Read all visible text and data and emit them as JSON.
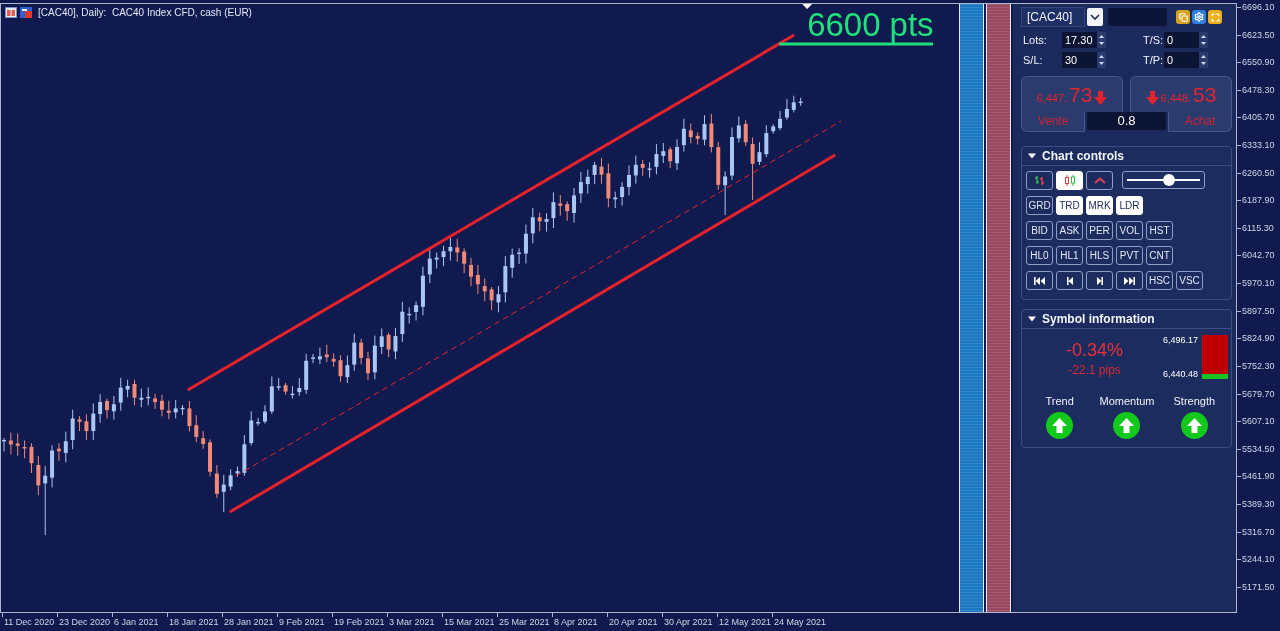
{
  "window": {
    "title": "[CAC40], Daily:  CAC40 Index CFD, cash (EUR)"
  },
  "chart": {
    "level_label": "6600 pts",
    "price_axis": [
      "6696.10",
      "6623.50",
      "6550.90",
      "6478.30",
      "6405.70",
      "6333.10",
      "6260.50",
      "6187.90",
      "6115.30",
      "6042.70",
      "5970.10",
      "5897.50",
      "5824.90",
      "5752.30",
      "5679.70",
      "5607.10",
      "5534.50",
      "5461.90",
      "5389.30",
      "5316.70",
      "5244.10",
      "5171.50"
    ],
    "date_axis": [
      "11 Dec 2020",
      "23 Dec 2020",
      "6 Jan 2021",
      "18 Jan 2021",
      "28 Jan 2021",
      "9 Feb 2021",
      "19 Feb 2021",
      "3 Mar 2021",
      "15 Mar 2021",
      "25 Mar 2021",
      "8 Apr 2021",
      "20 Apr 2021",
      "30 Apr 2021",
      "12 May 2021",
      "24 May 2021"
    ]
  },
  "trade_panel": {
    "symbol": "[CAC40]",
    "fields": [
      {
        "label": "Lots:",
        "value": "17.30"
      },
      {
        "label": "T/S:",
        "value": "0"
      },
      {
        "label": "S/L:",
        "value": "30"
      },
      {
        "label": "T/P:",
        "value": "0"
      }
    ],
    "quotes": [
      {
        "kind": "sell",
        "price_head": "6,447.",
        "price_tail": "73",
        "falling": true,
        "label": "Vente"
      },
      {
        "kind": "buy",
        "price_head": "6,448.",
        "price_tail": "53",
        "falling": true,
        "label": "Achat"
      }
    ],
    "spread": "0.8"
  },
  "chart_controls": {
    "title": "Chart controls",
    "expanded": true,
    "rows": [
      [
        {
          "kind": "icon",
          "selected": false
        },
        {
          "kind": "icon",
          "selected": true
        },
        {
          "kind": "icon",
          "selected": false
        },
        {
          "kind": "slider",
          "level": 0.58
        }
      ],
      [
        {
          "kind": "text",
          "label": "GRD",
          "selected": false
        },
        {
          "kind": "text",
          "label": "TRD",
          "selected": true
        },
        {
          "kind": "text",
          "label": "MRK",
          "selected": true
        },
        {
          "kind": "text",
          "label": "LDR",
          "selected": true
        }
      ],
      [
        {
          "kind": "text",
          "label": "BID",
          "selected": false
        },
        {
          "kind": "text",
          "label": "ASK",
          "selected": false
        },
        {
          "kind": "text",
          "label": "PER",
          "selected": false
        },
        {
          "kind": "text",
          "label": "VOL",
          "selected": false
        },
        {
          "kind": "text",
          "label": "HST",
          "selected": false
        }
      ],
      [
        {
          "kind": "text",
          "label": "HL0",
          "selected": false
        },
        {
          "kind": "text",
          "label": "HL1",
          "selected": false
        },
        {
          "kind": "text",
          "label": "HLS",
          "selected": false
        },
        {
          "kind": "text",
          "label": "PVT",
          "selected": false
        },
        {
          "kind": "text",
          "label": "CNT",
          "selected": false
        }
      ],
      [
        {
          "kind": "icon",
          "selected": false
        },
        {
          "kind": "icon",
          "selected": false
        },
        {
          "kind": "icon",
          "selected": false
        },
        {
          "kind": "icon",
          "selected": false
        },
        {
          "kind": "text",
          "label": "HSC",
          "selected": false
        },
        {
          "kind": "text",
          "label": "VSC",
          "selected": false
        }
      ]
    ]
  },
  "symbol_information": {
    "title": "Symbol information",
    "expanded": true,
    "change": "-0.34%",
    "pips": "-22.1 pips",
    "high": "6,496.17",
    "low": "6,440.48",
    "range": {
      "level": 0.12
    },
    "indicators": [
      {
        "label": "Trend",
        "rising": true
      },
      {
        "label": "Momentum",
        "rising": true
      },
      {
        "label": "Strength",
        "rising": true
      }
    ]
  }
}
